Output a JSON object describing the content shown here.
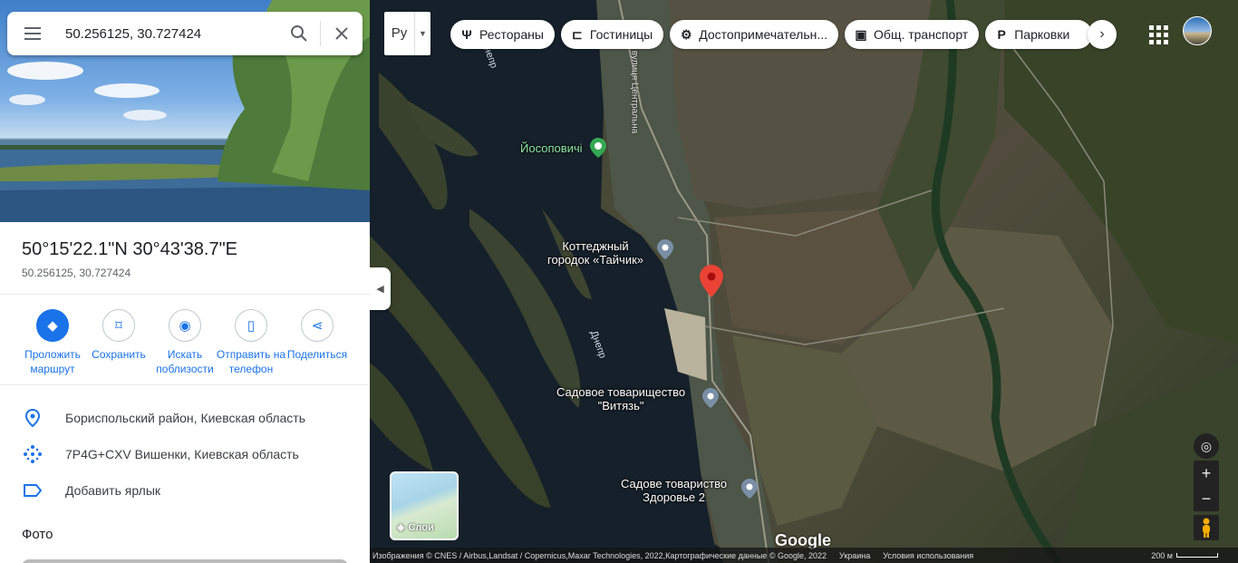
{
  "search": {
    "value": "50.256125, 30.727424"
  },
  "place": {
    "dms": "50°15'22.1\"N 30°43'38.7\"E",
    "decimal": "50.256125, 30.727424"
  },
  "actions": [
    {
      "label": "Проложить маршрут",
      "icon": "directions-icon"
    },
    {
      "label": "Сохранить",
      "icon": "bookmark-icon"
    },
    {
      "label": "Искать поблизости",
      "icon": "nearby-icon"
    },
    {
      "label": "Отправить на телефон",
      "icon": "phone-icon"
    },
    {
      "label": "Поделиться",
      "icon": "share-icon"
    }
  ],
  "info": {
    "region": "Бориспольский район, Киевская область",
    "plus_code": "7P4G+CXV Вишенки, Киевская область",
    "add_label": "Добавить ярлык"
  },
  "photos_title": "Фото",
  "map": {
    "lang": "Ру",
    "chips": [
      {
        "label": "Рестораны",
        "icon": "restaurant-icon"
      },
      {
        "label": "Гостиницы",
        "icon": "hotel-icon"
      },
      {
        "label": "Достопримечательн...",
        "icon": "attraction-icon"
      },
      {
        "label": "Общ. транспорт",
        "icon": "transit-icon"
      },
      {
        "label": "Парковки",
        "icon": "parking-icon"
      }
    ],
    "labels": {
      "yosypovychi": "Йосоповичі",
      "cottage": "Коттеджный\nгородок «Тайчик»",
      "garden1": "Садовое товарищество\n\"Витязь\"",
      "garden2": "Садове товариство\nЗдоровье 2",
      "river1": "Днепр",
      "river2": "Днепр",
      "street": "вулиця Центральна"
    },
    "layers_label": "Слои",
    "logo": "Google",
    "attribution": "Изображения © CNES / Airbus,Landsat / Copernicus,Maxar Technologies, 2022,Картографические данные © Google, 2022",
    "country": "Украина",
    "terms": "Условия использования",
    "scale": "200 м"
  },
  "colors": {
    "accent": "#1a73e8",
    "pin": "#ea4335"
  }
}
